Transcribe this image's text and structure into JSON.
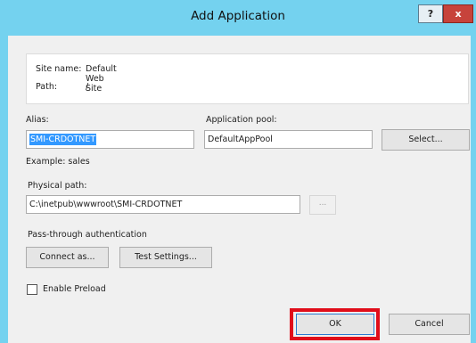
{
  "window": {
    "title": "Add Application",
    "help_label": "?",
    "close_label": "x"
  },
  "info": {
    "site_name_label": "Site name:",
    "site_name_value": "Default Web Site",
    "path_label": "Path:",
    "path_value": "/"
  },
  "alias": {
    "label": "Alias:",
    "value": "SMI-CRDOTNET",
    "example": "Example: sales"
  },
  "app_pool": {
    "label": "Application pool:",
    "value": "DefaultAppPool",
    "select_label": "Select..."
  },
  "physical_path": {
    "label": "Physical path:",
    "value": "C:\\inetpub\\wwwroot\\SMI-CRDOTNET",
    "browse_label": "..."
  },
  "auth": {
    "label": "Pass-through authentication",
    "connect_label": "Connect as...",
    "test_label": "Test Settings..."
  },
  "preload": {
    "label": "Enable Preload",
    "checked": false
  },
  "footer": {
    "ok_label": "OK",
    "cancel_label": "Cancel"
  },
  "colors": {
    "titlebar": "#74d2ef",
    "close_button": "#c7433b",
    "selection": "#3399ff",
    "highlight": "#e00d1a"
  }
}
